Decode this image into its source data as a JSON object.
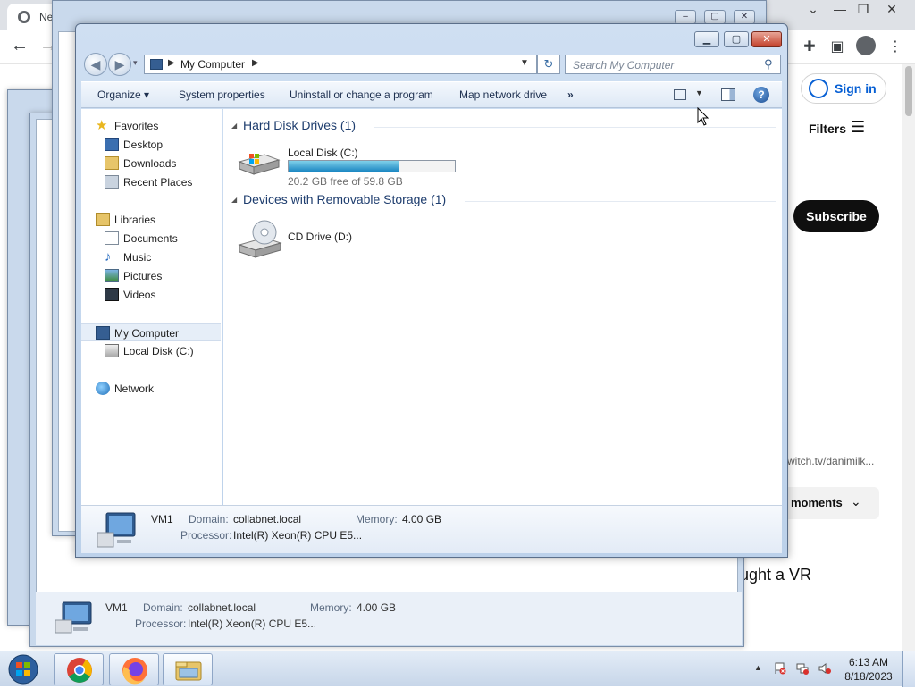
{
  "browser": {
    "tab_title": "Ne",
    "youtube": {
      "sign_in": "Sign in",
      "filters": "Filters",
      "subscribe": "Subscribe",
      "link_text": "witch.tv/danimilk...",
      "moments": "moments",
      "title_snippet": "ught a VR"
    }
  },
  "explorer": {
    "address": {
      "location": "My Computer"
    },
    "search": {
      "placeholder": "Search My Computer"
    },
    "toolbar": {
      "organize": "Organize",
      "system_properties": "System properties",
      "uninstall": "Uninstall or change a program",
      "map_drive": "Map network drive",
      "more": "»"
    },
    "nav_pane": {
      "favorites": "Favorites",
      "favorites_items": [
        "Desktop",
        "Downloads",
        "Recent Places"
      ],
      "libraries": "Libraries",
      "libraries_items": [
        "Documents",
        "Music",
        "Pictures",
        "Videos"
      ],
      "computer": "My Computer",
      "computer_items": [
        "Local Disk (C:)"
      ],
      "network": "Network"
    },
    "groups": {
      "hard_disk": "Hard Disk Drives (1)",
      "removable": "Devices with Removable Storage (1)"
    },
    "drives": {
      "c": {
        "name": "Local Disk (C:)",
        "free_text": "20.2 GB free of 59.8 GB",
        "used_fraction": 0.66
      },
      "d": {
        "name": "CD Drive (D:)"
      }
    },
    "details": {
      "computer_name": "VM1",
      "domain_label": "Domain:",
      "domain_value": "collabnet.local",
      "memory_label": "Memory:",
      "memory_value": "4.00 GB",
      "processor_label": "Processor:",
      "processor_value": "Intel(R) Xeon(R) CPU E5..."
    }
  },
  "taskbar": {
    "apps": [
      "chrome-icon",
      "firefox-icon",
      "windows-explorer-icon"
    ],
    "time": "6:13 AM",
    "date": "8/18/2023"
  },
  "colors": {
    "accent": "#1e3d6e",
    "progress": "#1b87c2",
    "subscribe_bg": "#0f0f0f",
    "signin_blue": "#065fd4"
  }
}
